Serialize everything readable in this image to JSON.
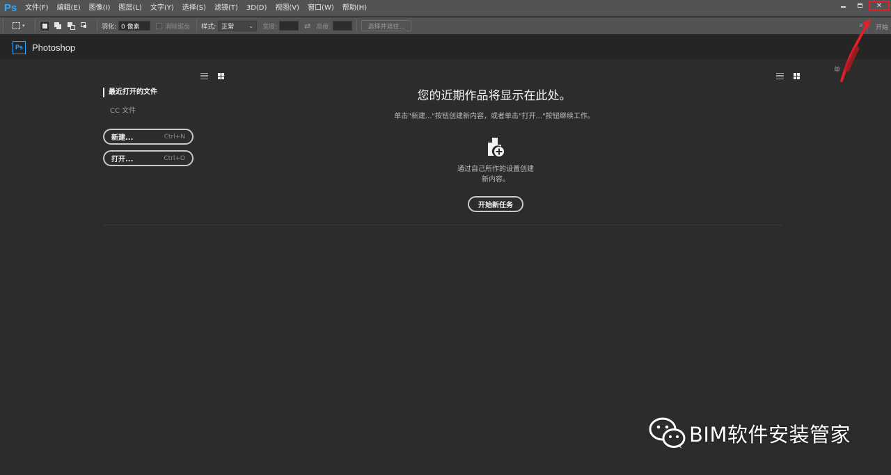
{
  "menubar": {
    "logo": "Ps",
    "items": [
      "文件(F)",
      "编辑(E)",
      "图像(I)",
      "图层(L)",
      "文字(Y)",
      "选择(S)",
      "滤镜(T)",
      "3D(D)",
      "视图(V)",
      "窗口(W)",
      "帮助(H)"
    ],
    "close_glyph": "✕"
  },
  "options": {
    "feather_label": "羽化:",
    "feather_value": "0 像素",
    "antialias_label": "消除锯齿",
    "style_label": "样式:",
    "style_value": "正常",
    "width_label": "宽度:",
    "height_label": "高度:",
    "select_mask_label": "选择并遮住...",
    "search_glyph": "⌕",
    "right_label": "开始"
  },
  "brand": {
    "icon_text": "Ps",
    "name": "Photoshop"
  },
  "start": {
    "recent_title": "最近打开的文件",
    "cc_files": "CC 文件",
    "new_button": {
      "label": "新建...",
      "shortcut": "Ctrl+N"
    },
    "open_button": {
      "label": "打开...",
      "shortcut": "Ctrl+O"
    },
    "hero_title": "您的近期作品将显示在此处。",
    "hero_sub": "单击\"新建...\"按钮创建新内容，或者单击\"打开...\"按钮继续工作。",
    "new_desc_line1": "通过自己所作的设置创建",
    "new_desc_line2": "新内容。",
    "start_task_label": "开始新任务"
  },
  "annotation": {
    "partial_char": "单"
  },
  "watermark": {
    "text": "BIM软件安装管家"
  },
  "colors": {
    "accent": "#31a8ff",
    "annotation_red": "#e0202a"
  }
}
